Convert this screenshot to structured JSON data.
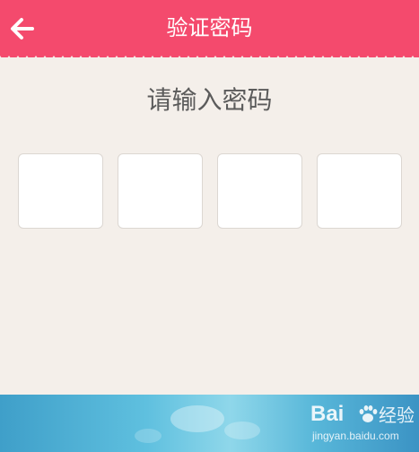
{
  "header": {
    "title": "验证密码",
    "accent_color": "#f44a6d",
    "back_icon": "arrow-left-icon"
  },
  "prompt": "请输入密码",
  "pin": {
    "length": 4,
    "boxes": [
      "",
      "",
      "",
      ""
    ]
  },
  "watermark": {
    "logo_text": "Bai",
    "logo_icon": "paw-icon",
    "logo_suffix": "经验",
    "url": "jingyan.baidu.com"
  }
}
